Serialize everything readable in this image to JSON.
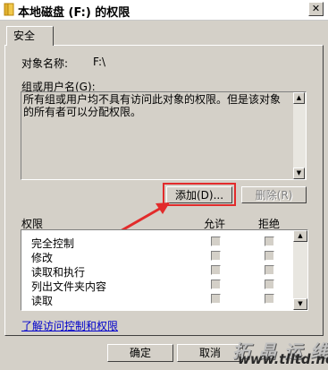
{
  "window": {
    "title": "本地磁盘 (F:) 的权限",
    "close_symbol": "✕"
  },
  "tabs": [
    {
      "label": "安全"
    }
  ],
  "object": {
    "label": "对象名称:",
    "value": "F:\\"
  },
  "groups": {
    "label": "组或用户名(G):",
    "message": "所有组或用户均不具有访问此对象的权限。但是该对象的所有者可以分配权限。"
  },
  "buttons": {
    "add": "添加(D)...",
    "remove": "删除(R)",
    "ok": "确定",
    "cancel": "取消"
  },
  "permissions": {
    "header": "权限",
    "allow_header": "允许",
    "deny_header": "拒绝",
    "rows": [
      {
        "label": "完全控制"
      },
      {
        "label": "修改"
      },
      {
        "label": "读取和执行"
      },
      {
        "label": "列出文件夹内容"
      },
      {
        "label": "读取"
      }
    ]
  },
  "link": {
    "label": "了解访问控制和权限"
  },
  "watermark": {
    "brand": "拓 晶 运 维",
    "url": "www.tlltd.net"
  },
  "colors": {
    "highlight": "#e22b2b",
    "link": "#0000cc"
  }
}
